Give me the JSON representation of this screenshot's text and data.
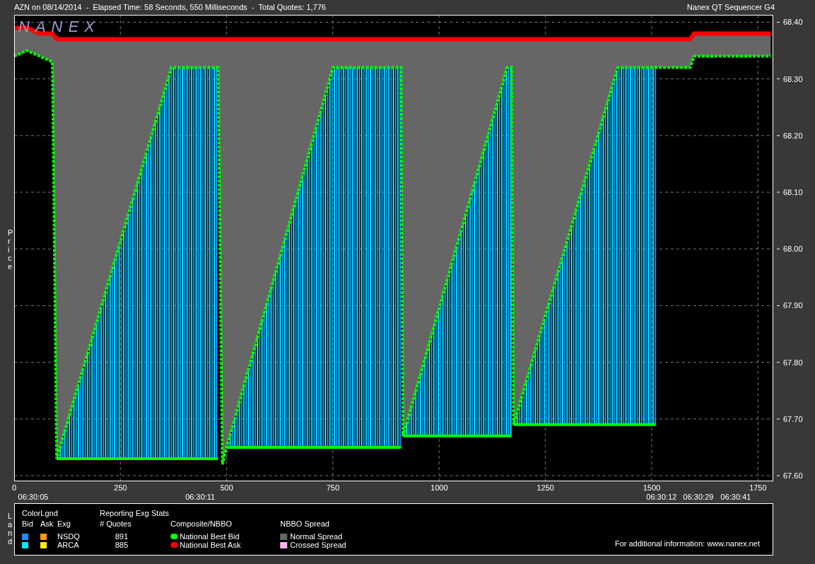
{
  "header": {
    "title": "AZN on 08/14/2014  -  Elapsed Time: 58 Seconds, 550 Milliseconds  -  Total Quotes: 1,776",
    "app": "Nanex QT Sequencer G4"
  },
  "chart": {
    "logo": "NANEX",
    "chart_data": {
      "type": "line",
      "ylabel": "Price",
      "grid": true,
      "x": [
        0,
        30,
        60,
        90,
        100,
        370,
        480,
        490,
        500,
        750,
        910,
        915,
        1160,
        1170,
        1175,
        1420,
        1510,
        1590,
        1600,
        1780
      ],
      "series": [
        {
          "name": "National Best Ask",
          "color": "#ff0000",
          "values": [
            68.39,
            68.39,
            68.38,
            68.38,
            68.37,
            68.37,
            68.37,
            68.37,
            68.37,
            68.37,
            68.37,
            68.37,
            68.37,
            68.37,
            68.37,
            68.37,
            68.37,
            68.37,
            68.38,
            68.38
          ]
        },
        {
          "name": "National Best Bid",
          "color": "#00ff00",
          "line_style": "dashed",
          "values": [
            68.34,
            68.35,
            68.34,
            68.33,
            67.63,
            68.32,
            68.32,
            67.62,
            67.65,
            68.32,
            68.32,
            67.67,
            68.32,
            68.32,
            67.69,
            68.32,
            68.32,
            68.32,
            68.34,
            68.34
          ]
        }
      ],
      "xlim": [
        0,
        1786
      ],
      "ylim": [
        67.59,
        68.413
      ],
      "xticks": [
        0,
        250,
        500,
        750,
        1000,
        1250,
        1500,
        1750
      ],
      "yticks": [
        {
          "value": 67.6,
          "label": "67.60"
        },
        {
          "value": 67.7,
          "label": "67.70"
        },
        {
          "value": 67.8,
          "label": "67.80"
        },
        {
          "value": 67.9,
          "label": "67.90"
        },
        {
          "value": 68.0,
          "label": "68.00"
        },
        {
          "value": 68.1,
          "label": "68.10"
        },
        {
          "value": 68.2,
          "label": "68.20"
        },
        {
          "value": 68.3,
          "label": "68.30"
        },
        {
          "value": 68.4,
          "label": "68.40"
        }
      ]
    },
    "time_labels": [
      "06:30:05",
      "06:30:11",
      "06:30:12",
      "06:30:29",
      "06:30:41"
    ]
  },
  "legend": {
    "side_label": "Land",
    "color_legend": {
      "title": "ColorLgnd",
      "columns": [
        "Bid",
        "Ask",
        "Exg"
      ]
    },
    "stats": {
      "title": "Reporting Exg Stats",
      "column": "# Quotes"
    },
    "exchanges": [
      {
        "exchange": "NSDQ",
        "quotes": "891",
        "bid": {
          "color": "#1a90ff"
        },
        "ask": {
          "color": "#ff9900"
        }
      },
      {
        "exchange": "ARCA",
        "quotes": "885",
        "bid": {
          "color": "#00eaff"
        },
        "ask": {
          "color": "#ffee00"
        }
      }
    ],
    "nbbo": {
      "title": "Composite/NBBO"
    },
    "spread": {
      "title": "NBBO Spread",
      "items": [
        {
          "label": "Normal Spread",
          "color": "#666666"
        },
        {
          "label": "Crossed Spread",
          "color": "#ffb3e6"
        }
      ]
    },
    "info": "For additional information: www.nanex.net"
  }
}
